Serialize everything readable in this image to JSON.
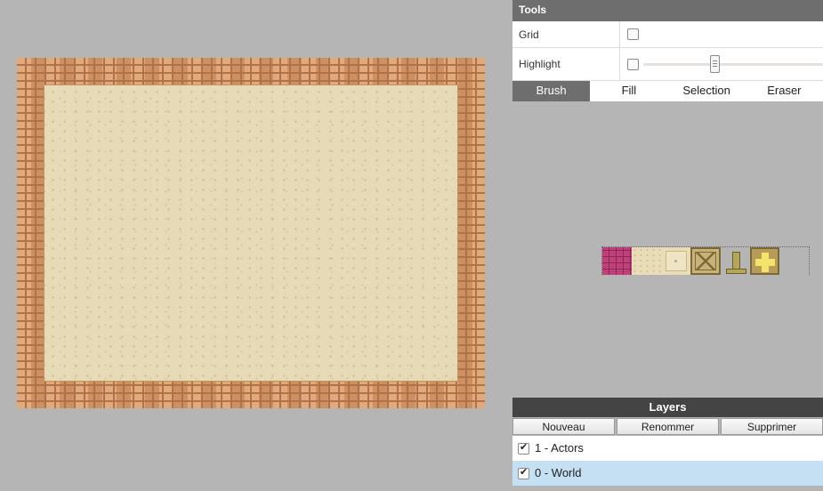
{
  "tools": {
    "title": "Tools",
    "grid": {
      "label": "Grid",
      "checked": false
    },
    "highlight": {
      "label": "Highlight",
      "checked": false,
      "slider_value": 0.4
    }
  },
  "tabs": [
    {
      "label": "Brush",
      "active": true
    },
    {
      "label": "Fill",
      "active": false
    },
    {
      "label": "Selection",
      "active": false
    },
    {
      "label": "Eraser",
      "active": false
    }
  ],
  "tileset": [
    "wall-tile",
    "sand-tile",
    "target-tile",
    "crate-tile",
    "post-tile",
    "gem-tile",
    "empty-tile"
  ],
  "layers": {
    "title": "Layers",
    "buttons": {
      "new": "Nouveau",
      "rename": "Renommer",
      "delete": "Supprimer"
    },
    "items": [
      {
        "index": "1 -",
        "name": "Actors",
        "visible": true,
        "selected": false
      },
      {
        "index": "0 -",
        "name": "World",
        "visible": true,
        "selected": true
      }
    ]
  },
  "colors": {
    "header": "#6e6e6e",
    "layers_header": "#444444",
    "selected_layer": "#c5dff3",
    "floor": "#e6dbb6",
    "wall": "#d89e6c"
  }
}
